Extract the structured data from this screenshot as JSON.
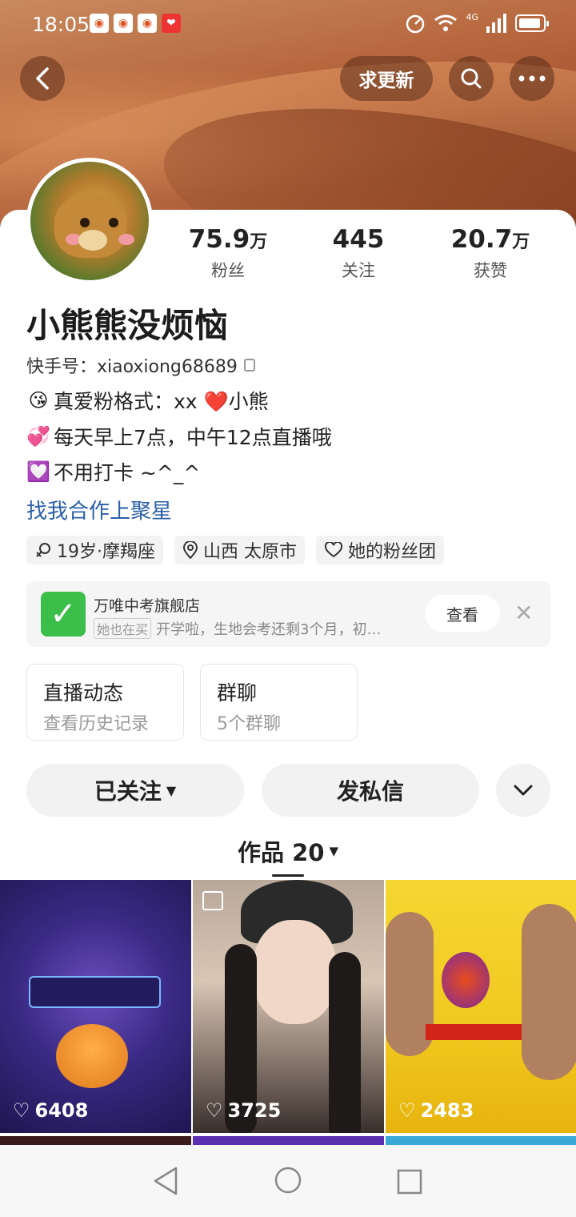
{
  "status": {
    "time": "18:05",
    "network": "4G"
  },
  "nav": {
    "update_label": "求更新"
  },
  "profile": {
    "name": "小熊熊没烦恼",
    "kuaishou_id": "快手号：xiaoxiong68689",
    "bio": [
      {
        "icon": "kiss-emoji",
        "text": "真爱粉格式：xx ❤️小熊"
      },
      {
        "icon": "sparkling-heart-emoji",
        "text": "每天早上7点，中午12点直播哦"
      },
      {
        "icon": "purple-heart-emoji",
        "text": "不用打卡 ~^_^"
      }
    ],
    "link": "找我合作上聚星",
    "tags": [
      "19岁·摩羯座",
      "山西 太原市",
      "她的粉丝团"
    ]
  },
  "stats": [
    {
      "num": "75.9",
      "unit": "万",
      "label": "粉丝"
    },
    {
      "num": "445",
      "unit": "",
      "label": "关注"
    },
    {
      "num": "20.7",
      "unit": "万",
      "label": "获赞"
    }
  ],
  "shop": {
    "title": "万唯中考旗舰店",
    "badge": "她也在买",
    "desc": "开学啦，生地会考还剩3个月，初…",
    "button": "查看"
  },
  "boxes": [
    {
      "title": "直播动态",
      "sub": "查看历史记录"
    },
    {
      "title": "群聊",
      "sub": "5个群聊"
    }
  ],
  "actions": {
    "follow": "已关注",
    "message": "发私信"
  },
  "tabs": {
    "works": "作品 20"
  },
  "works": [
    {
      "likes": "6408"
    },
    {
      "likes": "3725"
    },
    {
      "likes": "2483"
    }
  ],
  "colors": {
    "link": "#2c5fa8",
    "shop_logo": "#3bbf4a",
    "accent_bg": "#a55430"
  }
}
